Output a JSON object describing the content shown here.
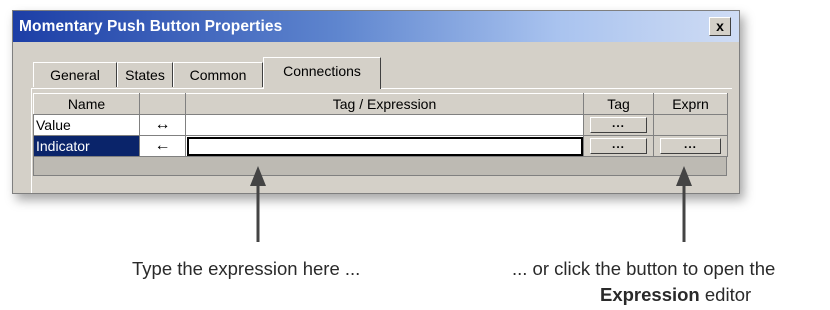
{
  "window": {
    "title": "Momentary Push Button Properties",
    "close_label": "x"
  },
  "tabs": [
    {
      "label": "General",
      "active": false
    },
    {
      "label": "States",
      "active": false
    },
    {
      "label": "Common",
      "active": false
    },
    {
      "label": "Connections",
      "active": true
    }
  ],
  "grid": {
    "columns": [
      "Name",
      "",
      "Tag / Expression",
      "Tag",
      "Exprn"
    ],
    "rows": [
      {
        "name": "Value",
        "direction": "↔",
        "expression": "",
        "tag_button": "...",
        "exprn_button": "",
        "selected": false
      },
      {
        "name": "Indicator",
        "direction": "←",
        "expression": "",
        "tag_button": "...",
        "exprn_button": "...",
        "selected": true
      }
    ]
  },
  "annotations": {
    "left": "Type the expression here ...",
    "right_line1": "... or click the button to open the",
    "right_bold": "Expression",
    "right_rest": " editor"
  },
  "colors": {
    "title_gradient_start": "#1c3ea6",
    "dialog_bg": "#d4d0c8",
    "selection": "#0a246a"
  }
}
